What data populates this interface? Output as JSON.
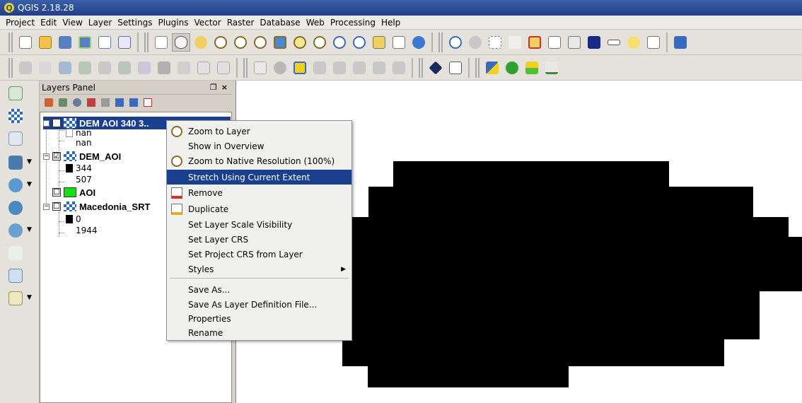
{
  "window": {
    "title": "QGIS 2.18.28",
    "app_icon": "qgis-icon"
  },
  "menubar": [
    "Project",
    "Edit",
    "View",
    "Layer",
    "Settings",
    "Plugins",
    "Vector",
    "Raster",
    "Database",
    "Web",
    "Processing",
    "Help"
  ],
  "layers_panel": {
    "title": "Layers Panel",
    "float_glyph": "❐",
    "close_glyph": "×",
    "layers": [
      {
        "name": "DEM AOI 340 3..",
        "checked": "☑",
        "legend": [
          "nan",
          "nan"
        ]
      },
      {
        "name": "DEM_AOI",
        "checked": "☑",
        "legend": [
          "344",
          "507"
        ]
      },
      {
        "name": "AOI",
        "checked": "☐",
        "legend": []
      },
      {
        "name": "Macedonia_SRT",
        "checked": "☐",
        "legend": [
          "0",
          "1944"
        ]
      }
    ]
  },
  "context_menu": {
    "items": [
      "Zoom to Layer",
      "Show in Overview",
      "Zoom to Native Resolution (100%)",
      "Stretch Using Current Extent",
      "Remove",
      "Duplicate",
      "Set Layer Scale Visibility",
      "Set Layer CRS",
      "Set Project CRS from Layer",
      "Styles",
      "Save As...",
      "Save As Layer Definition File...",
      "Properties",
      "Rename"
    ],
    "highlighted": "Stretch Using Current Extent",
    "submenu_arrow": "▶"
  },
  "colors": {
    "selection": "#1a3f8c",
    "titlebar": "#2a4d97",
    "vector_fill": "#18e018"
  }
}
